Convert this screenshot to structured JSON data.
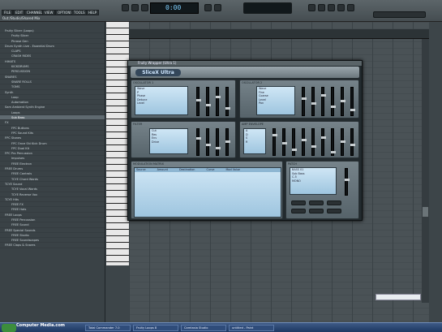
{
  "topbar": {
    "menu": [
      "FILE",
      "EDIT",
      "CHANNELS",
      "VIEW",
      "OPTIONS",
      "TOOLS",
      "HELP"
    ],
    "hint": "Out:/Studio/Shared Mix",
    "lcd": "0:00"
  },
  "browser": {
    "items": [
      {
        "label": "Fruity Slicer (Loops)"
      },
      {
        "label": "Fruity Slicer"
      },
      {
        "label": "Phrase Gen"
      },
      {
        "label": "Drum Synth Live - Essential Drum"
      },
      {
        "label": "CLAPS"
      },
      {
        "label": "CRASH RIDES"
      },
      {
        "label": "HIHATS"
      },
      {
        "label": "KICKDRUMS"
      },
      {
        "label": "PERCUSSION"
      },
      {
        "label": "SNARES"
      },
      {
        "label": "SNARE ROLLS"
      },
      {
        "label": "TOMS"
      },
      {
        "label": "Synth"
      },
      {
        "label": "Loop"
      },
      {
        "label": "Automation"
      },
      {
        "label": "Sam Ambient Synth Engine"
      },
      {
        "label": "Loops"
      },
      {
        "label": "Sub Bass",
        "selected": true
      },
      {
        "label": "FX"
      },
      {
        "label": "FPC Buttons"
      },
      {
        "label": "FPC Sound Kits"
      },
      {
        "label": "FPC Stones"
      },
      {
        "label": "FPC Once Shi Kick Drum"
      },
      {
        "label": "FPC Dual Kit"
      },
      {
        "label": "FPC Pro Percussion"
      },
      {
        "label": "Impulses"
      },
      {
        "label": "FREE Electron"
      },
      {
        "label": "FREE Drums"
      },
      {
        "label": "FREE Controls"
      },
      {
        "label": "TCYE Chord Words"
      },
      {
        "label": "TCYE Sound"
      },
      {
        "label": "TCYE Vocal Words"
      },
      {
        "label": "TCYE Reverse Vox"
      },
      {
        "label": "TCYE Hits"
      },
      {
        "label": "FREE FX"
      },
      {
        "label": "FREE Hats"
      },
      {
        "label": "FREE Loops"
      },
      {
        "label": "FREE Percussion"
      },
      {
        "label": "FREE Sound"
      },
      {
        "label": "FREE Special Sounds"
      },
      {
        "label": "FREE Studio"
      },
      {
        "label": "FREE Soundscapes"
      },
      {
        "label": "FREE Claps & Snares"
      }
    ]
  },
  "plugin": {
    "window_title": "Fruity Wrapper (Ultra 1)",
    "logo": "SliceX Ultra",
    "panels": {
      "osc1": {
        "title": "OSCILLATOR 1",
        "lines": [
          "Wave",
          "P",
          "Phase",
          "Detune",
          "Level"
        ]
      },
      "osc2": {
        "title": "OSCILLATOR 2",
        "lines": [
          "Wave",
          "Fine",
          "Coarse",
          "Level",
          "Pan"
        ]
      },
      "filter": {
        "title": "FILTER",
        "lines": [
          "Cut",
          "Res",
          "Env",
          "Drive"
        ]
      },
      "envelope": {
        "title": "AMP ENVELOPE",
        "lines": [
          "A",
          "D",
          "S",
          "R"
        ]
      },
      "modmatrix": {
        "title": "MODULATION MATRIX",
        "cols": [
          "Source",
          "Amount",
          "Destination",
          "Curve",
          "Mod Value"
        ]
      },
      "patch": {
        "title": "PATCH",
        "lines": [
          "BASS 01",
          "Sub Bass",
          "C-5",
          "MONO"
        ]
      }
    }
  },
  "taskbar": {
    "start": "start",
    "items": [
      "Total Commander 7.0",
      "Fruity Loops 8",
      "Camtasia Studio",
      "untitled - Paint"
    ],
    "watermark": "Computer Media.com"
  }
}
